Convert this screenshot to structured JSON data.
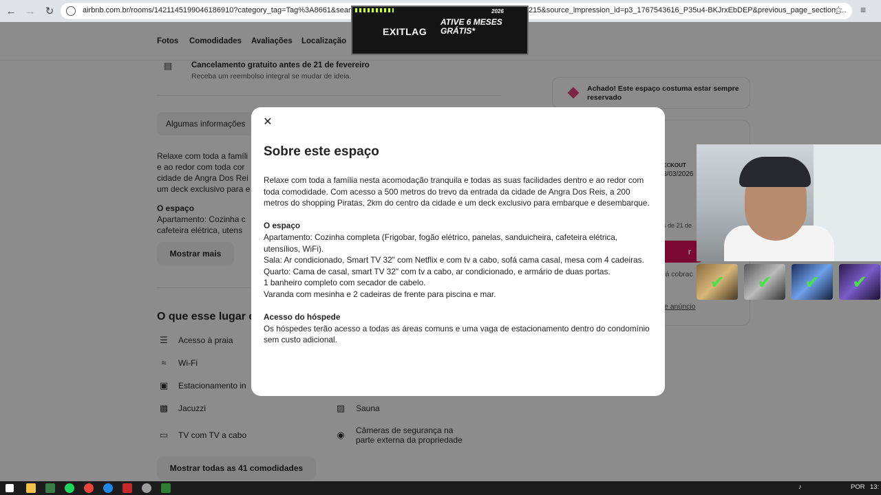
{
  "browser": {
    "url_visible_start": "airbnb.com.br/rooms/1421145199046186910?category_tag=Tag%3A8661&search",
    "url_visible_end": "215&source_impression_id=p3_1767543616_P35u4-BKJrxEbDEP&previous_page_section_..."
  },
  "page": {
    "subnav": [
      "Fotos",
      "Comodidades",
      "Avaliações",
      "Localização"
    ],
    "cancel_title": "Cancelamento gratuito antes de 21 de fevereiro",
    "cancel_sub": "Receba um reembolso integral se mudar de ideia.",
    "info_box": "Algumas informações",
    "desc_lines": [
      "Relaxe com toda a famíli",
      "e ao redor com toda cor",
      "cidade de Angra Dos Rei",
      "um deck exclusivo para e"
    ],
    "space_title": "O espaço",
    "space_lines": [
      "Apartamento: Cozinha c",
      "cafeteira elétrica, utens"
    ],
    "show_more": "Mostrar mais",
    "amenities_title": "O que esse lugar o",
    "amenities_left": [
      "Acesso à praia",
      "Wi-Fi",
      "Estacionamento in",
      "Jacuzzi",
      "TV com TV a cabo"
    ],
    "amenities_right": [
      "Sauna",
      "Câmeras de segurança na",
      "parte externa da propriedade"
    ],
    "show_all": "Mostrar todas as 41 comodidades",
    "side_notice": "Achado! Este espaço costuma estar sempre reservado",
    "booking_fragments": {
      "checkout": "ECKOUT",
      "date": "3/03/2026",
      "cancel_date": "s de 21 de",
      "reserve": "r",
      "charge": "rá cobrac",
      "report": "te anúncio"
    }
  },
  "modal": {
    "close_icon": "close-icon",
    "title": "Sobre este espaço",
    "intro": "Relaxe com toda a família nesta acomodação tranquila e todas as suas facilidades dentro e ao redor com toda comodidade. Com acesso a 500 metros do trevo da entrada da cidade de Angra Dos Reis, a 200 metros do shopping Piratas, 2km do centro da cidade e um deck exclusivo para embarque e desembarque.",
    "space_heading": "O espaço",
    "space_lines": [
      "Apartamento: Cozinha completa (Frigobar, fogão elétrico, panelas, sanduicheira, cafeteira elétrica, utensílios, WiFi).",
      "Sala: Ar condicionado, Smart TV 32\" com Netflix e com tv a cabo, sofá cama casal, mesa com 4 cadeiras.",
      "Quarto: Cama de casal, smart TV 32\" com tv a cabo, ar condicionado, e armário de duas portas.",
      "1 banheiro completo com secador de cabelo.",
      "Varanda com mesinha e 2 cadeiras de frente para piscina e mar."
    ],
    "guest_heading": "Acesso do hóspede",
    "guest_text": "Os hóspedes terão acesso a todas as áreas comuns e uma vaga de estacionamento dentro do condomínio sem custo adicional."
  },
  "ad": {
    "logo": "EXITLAG",
    "slogan": "ATIVE 6 MESES GRÁTIS*",
    "year": "2026"
  },
  "taskbar": {
    "lang": "POR",
    "time": "13:"
  },
  "colors": {
    "accent": "#e1115c",
    "overlay": "rgba(0,0,0,0.45)"
  }
}
